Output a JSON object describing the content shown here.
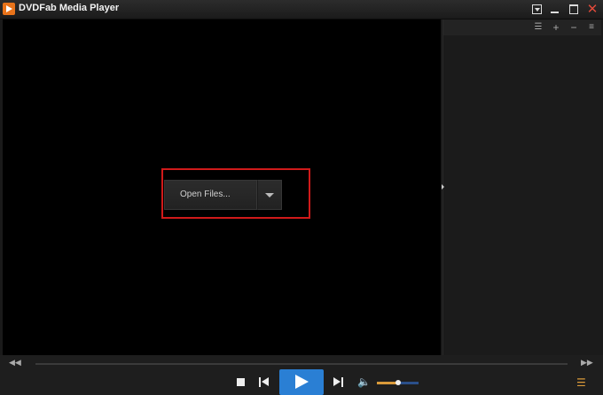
{
  "window": {
    "title": "DVDFab Media Player",
    "close_glyph": "✕"
  },
  "playlist": {
    "list_glyph": "☰",
    "add_glyph": "+",
    "remove_glyph": "−",
    "sort_glyph": "≡"
  },
  "open_files": {
    "label": "Open Files..."
  },
  "controls": {
    "seek_back_glyph": "◀◀",
    "seek_forward_glyph": "▶▶",
    "volume_glyph": "🔈",
    "volume_level_percent": 50,
    "playlist_toggle_glyph": "☰"
  },
  "colors": {
    "accent_play": "#2a7fd4",
    "highlight_box": "#d01a1a",
    "volume_fill": "#d99a3a"
  }
}
